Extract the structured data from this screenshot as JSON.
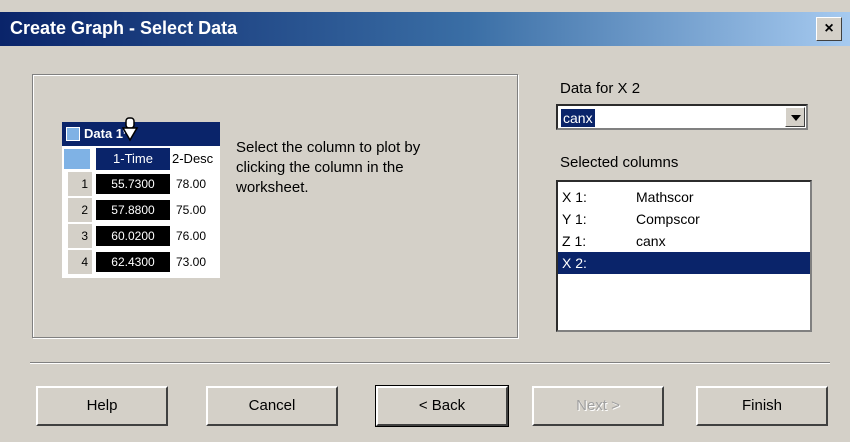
{
  "window": {
    "title": "Create Graph - Select Data",
    "close_label": "×"
  },
  "preview": {
    "title": "Data 1*",
    "header_col1": "1-Time",
    "header_col2": "2-Desc",
    "rows": [
      {
        "num": "1",
        "c1": "55.7300",
        "c2": "78.00"
      },
      {
        "num": "2",
        "c1": "57.8800",
        "c2": "75.00"
      },
      {
        "num": "3",
        "c1": "60.0200",
        "c2": "76.00"
      },
      {
        "num": "4",
        "c1": "62.4300",
        "c2": "73.00"
      }
    ]
  },
  "instruction": "Select the column to plot by\nclicking the column in the\nworksheet.",
  "data_for": {
    "label": "Data for X 2",
    "value": "canx"
  },
  "selected_columns": {
    "label": "Selected columns",
    "items": [
      {
        "key": "X 1:",
        "value": "Mathscor"
      },
      {
        "key": "Y 1:",
        "value": "Compscor"
      },
      {
        "key": "Z 1:",
        "value": "canx"
      },
      {
        "key": "X 2:",
        "value": ""
      }
    ]
  },
  "buttons": {
    "help": "Help",
    "cancel": "Cancel",
    "back": "< Back",
    "next": "Next >",
    "finish": "Finish"
  }
}
